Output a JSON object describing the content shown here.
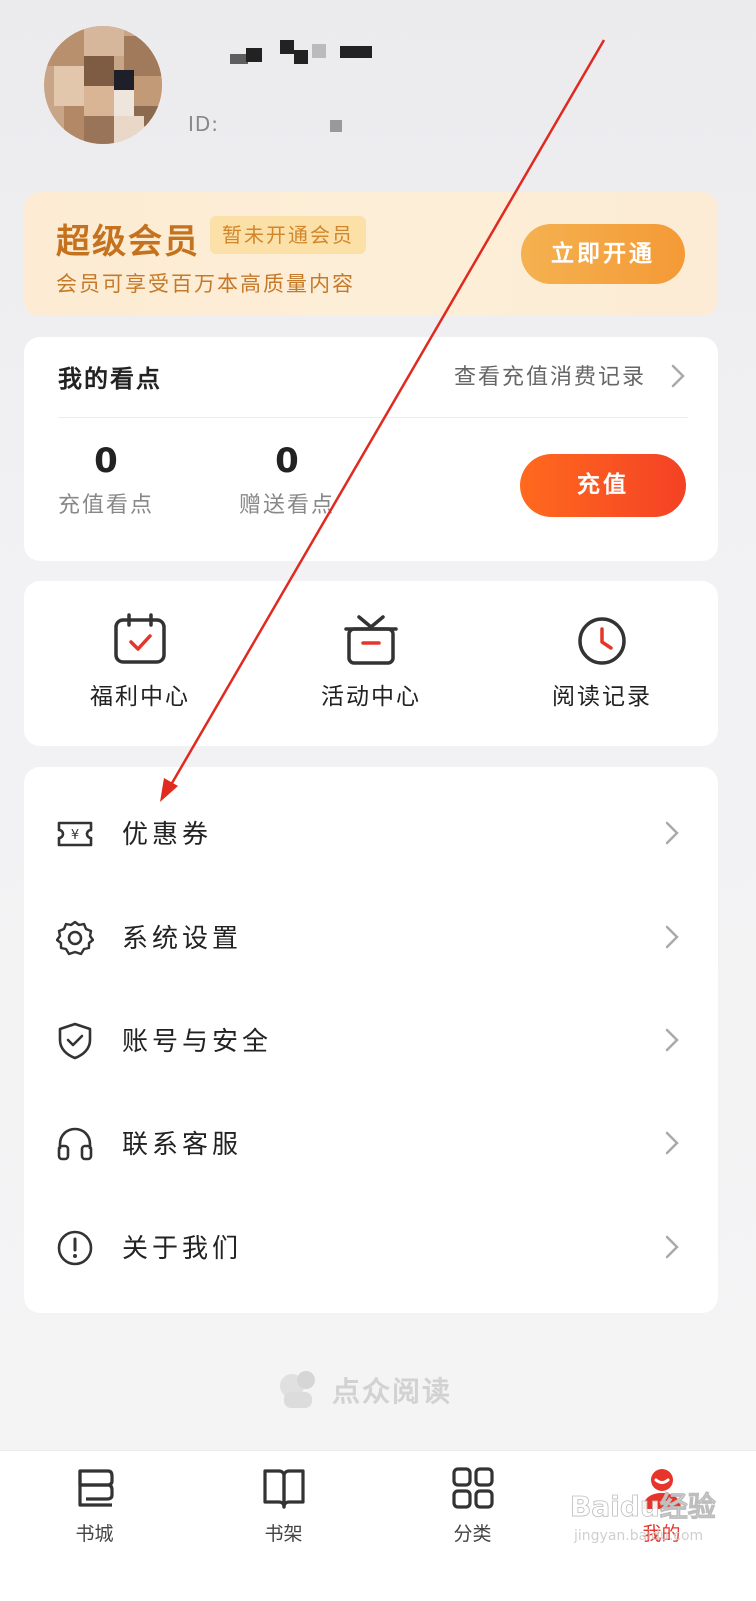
{
  "profile": {
    "id_label": "ID:"
  },
  "vip": {
    "title": "超级会员",
    "badge": "暂未开通会员",
    "subtitle": "会员可享受百万本高质量内容",
    "button": "立即开通"
  },
  "points": {
    "title": "我的看点",
    "history_link": "查看充值消费记录",
    "recharge_value": "0",
    "recharge_label": "充值看点",
    "gift_value": "0",
    "gift_label": "赠送看点",
    "recharge_button": "充值"
  },
  "quick": [
    {
      "label": "福利中心",
      "icon": "calendar-check-icon"
    },
    {
      "label": "活动中心",
      "icon": "gift-icon"
    },
    {
      "label": "阅读记录",
      "icon": "clock-icon"
    }
  ],
  "menu": [
    {
      "label": "优惠券",
      "icon": "coupon-icon"
    },
    {
      "label": "系统设置",
      "icon": "gear-icon"
    },
    {
      "label": "账号与安全",
      "icon": "shield-icon"
    },
    {
      "label": "联系客服",
      "icon": "headset-icon"
    },
    {
      "label": "关于我们",
      "icon": "info-icon"
    }
  ],
  "brand": {
    "name": "点众阅读"
  },
  "tabbar": [
    {
      "label": "书城",
      "icon": "bookstore-icon",
      "active": false
    },
    {
      "label": "书架",
      "icon": "bookshelf-icon",
      "active": false
    },
    {
      "label": "分类",
      "icon": "category-icon",
      "active": false
    },
    {
      "label": "我的",
      "icon": "profile-icon",
      "active": true
    }
  ],
  "watermark": {
    "text": "Baidu经验",
    "url_text": "jingyan.baidu.com"
  },
  "colors": {
    "vip_title": "#c4721e",
    "vip_button": "#f4a340",
    "recharge_button": "#f74f22",
    "accent_red": "#e6352b",
    "annotation_arrow": "#e02a20"
  }
}
